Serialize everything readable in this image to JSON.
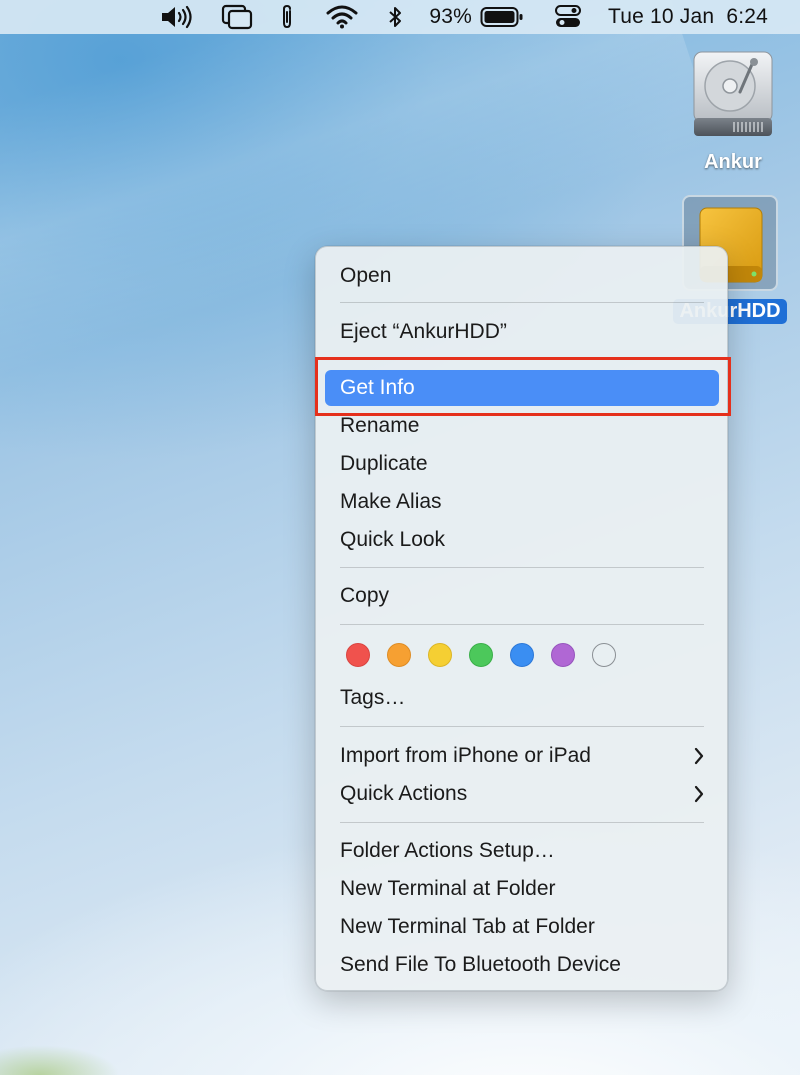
{
  "menubar": {
    "battery_percent": "93%",
    "datetime": "Tue 10 Jan  6:24",
    "icons": [
      "volume-icon",
      "screen-mirroring-icon",
      "paperclip-icon",
      "wifi-icon",
      "bluetooth-icon",
      "battery-icon",
      "control-center-icon"
    ]
  },
  "desktop": {
    "drives": [
      {
        "label": "Ankur",
        "icon": "internal-disk-icon"
      },
      {
        "label": "AnkurHDD",
        "icon": "external-drive-icon",
        "selected": true
      }
    ]
  },
  "context_menu": {
    "items": [
      {
        "label": "Open"
      },
      {
        "label": "Eject “AnkurHDD”"
      },
      {
        "label": "Get Info",
        "selected": true,
        "highlighted": true
      },
      {
        "label": "Rename"
      },
      {
        "label": "Duplicate"
      },
      {
        "label": "Make Alias"
      },
      {
        "label": "Quick Look"
      },
      {
        "label": "Copy"
      },
      {
        "label": "Tags…"
      },
      {
        "label": "Import from iPhone or iPad",
        "submenu": true
      },
      {
        "label": "Quick Actions",
        "submenu": true
      },
      {
        "label": "Folder Actions Setup…"
      },
      {
        "label": "New Terminal at Folder"
      },
      {
        "label": "New Terminal Tab at Folder"
      },
      {
        "label": "Send File To Bluetooth Device"
      }
    ],
    "tag_colors": [
      {
        "name": "red",
        "color": "#f0524d"
      },
      {
        "name": "orange",
        "color": "#f6a032"
      },
      {
        "name": "yellow",
        "color": "#f5cf33"
      },
      {
        "name": "green",
        "color": "#4cc85b"
      },
      {
        "name": "blue",
        "color": "#3a8ef2"
      },
      {
        "name": "purple",
        "color": "#b067d4"
      },
      {
        "name": "none",
        "color": "transparent"
      }
    ],
    "selection_color": "#4a8ef7",
    "annotation_color": "#e5301c"
  }
}
